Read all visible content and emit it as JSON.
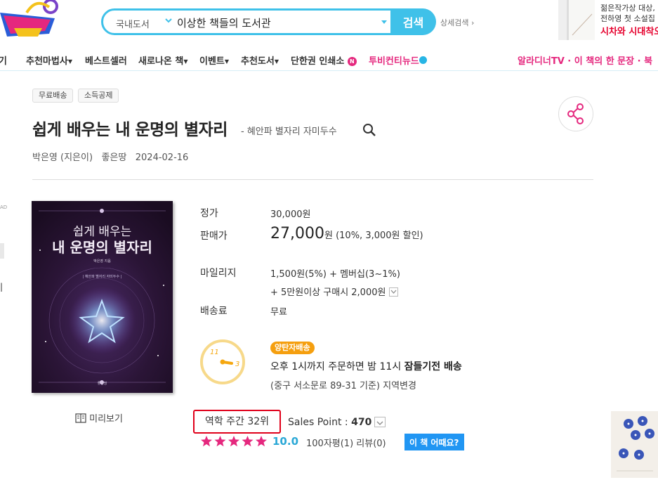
{
  "colors": {
    "accent": "#3fc1e9",
    "brand_pink": "#e5287e",
    "rank_red": "#e0001a",
    "star_pink": "#e5287e",
    "rating_blue": "#2ba8d6",
    "delivery_orange": "#f59f0f"
  },
  "header": {
    "logo_icon": "magic-lamp-logo",
    "search": {
      "category": "국내도서",
      "query": "이상한 책들의 도서관",
      "button": "검색"
    },
    "advanced_search": "상세검색",
    "ad": {
      "line1": "젊은작가상 대상,",
      "line2": "전하영 첫 소설집",
      "line3": "시차와 시대착오"
    }
  },
  "nav": {
    "items": [
      {
        "label": "기"
      },
      {
        "label": "추천마법사"
      },
      {
        "label": "베스트셀러"
      },
      {
        "label": "새로나온 책"
      },
      {
        "label": "이벤트"
      },
      {
        "label": "추천도서"
      },
      {
        "label": "단한권 인쇄소"
      },
      {
        "label": "투비컨티뉴드"
      }
    ],
    "new_badge": "N",
    "right_label": "알라디너TV · 이 책의 한 문장 · 북"
  },
  "product": {
    "badges": [
      "무료배송",
      "소득공제"
    ],
    "title": "쉽게 배우는 내 운명의 별자리",
    "subtitle": "- 혜안파 별자리 자미두수",
    "author": "박은영 (지은이)",
    "publisher": "좋은땅",
    "date": "2024-02-16",
    "cover": {
      "top_text": "쉽게 배우는",
      "main_text": "내 운명의 별자리",
      "author_text": "박은영 지음",
      "sub_text": "| 혜안파 별자리 자미두수 |",
      "publisher_text": "좋은땅"
    },
    "preview_label": "미리보기",
    "price": {
      "list_label": "정가",
      "list_value": "30,000원",
      "sale_label": "판매가",
      "sale_number": "27,000",
      "sale_unit": "원",
      "sale_discount": "(10%, 3,000원 할인)"
    },
    "mileage": {
      "label": "마일리지",
      "line1": "1,500원(5%) + 멤버십(3~1%)",
      "line2": "+ 5만원이상 구매시 2,000원"
    },
    "shipping": {
      "label": "배송료",
      "value": "무료"
    },
    "delivery": {
      "clock_hour_a": "11",
      "clock_hour_b": "3",
      "badge": "양탄자배송",
      "line1_prefix": "오후 1시까지 주문하면 밤 11시 ",
      "line1_bold": "잠들기전 배송",
      "line2": "(중구 서소문로 89-31 기준) 지역변경"
    },
    "rank": "역학 주간 32위",
    "sales_point_label": "Sales Point : ",
    "sales_point_value": "470",
    "rating": "10.0",
    "rating_stars": 5,
    "review_summary": "100자평(1)  리뷰(0)",
    "how_button": "이 책 어때요?"
  },
  "edge": {
    "ad_fragment": "AD",
    "glyph_fragment": "|"
  }
}
